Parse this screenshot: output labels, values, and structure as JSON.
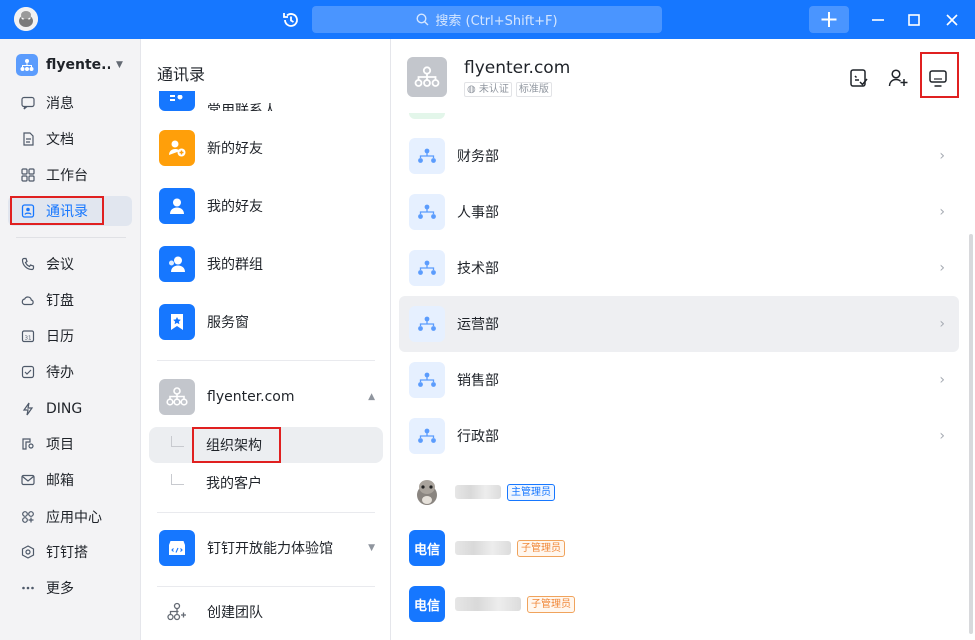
{
  "titlebar": {
    "search_placeholder": "搜索 (Ctrl+Shift+F)"
  },
  "sidebar": {
    "org_name": "flyente...",
    "items": [
      {
        "label": "消息",
        "icon": "message-icon"
      },
      {
        "label": "文档",
        "icon": "document-icon"
      },
      {
        "label": "工作台",
        "icon": "workbench-icon"
      },
      {
        "label": "通讯录",
        "icon": "contacts-icon",
        "active": true
      },
      {
        "label": "会议",
        "icon": "phone-icon"
      },
      {
        "label": "钉盘",
        "icon": "cloud-drive-icon"
      },
      {
        "label": "日历",
        "icon": "calendar-icon"
      },
      {
        "label": "待办",
        "icon": "todo-icon"
      },
      {
        "label": "DING",
        "icon": "ding-icon"
      },
      {
        "label": "项目",
        "icon": "project-icon"
      },
      {
        "label": "邮箱",
        "icon": "mail-icon"
      },
      {
        "label": "应用中心",
        "icon": "app-center-icon"
      },
      {
        "label": "钉钉搭",
        "icon": "builder-icon"
      },
      {
        "label": "更多",
        "icon": "more-icon"
      }
    ]
  },
  "middle": {
    "title": "通讯录",
    "partial_item": "常用联系人",
    "items": [
      {
        "label": "新的好友",
        "color": "#ff9f0a"
      },
      {
        "label": "我的好友",
        "color": "#1677ff"
      },
      {
        "label": "我的群组",
        "color": "#1677ff"
      },
      {
        "label": "服务窗",
        "color": "#1677ff"
      }
    ],
    "org": {
      "name": "flyenter.com"
    },
    "org_sub": [
      "组织架构",
      "我的客户"
    ],
    "experience": "钉钉开放能力体验馆",
    "create_team": "创建团队"
  },
  "right": {
    "org_title": "flyenter.com",
    "tags": [
      "未认证",
      "标准版"
    ],
    "departments": [
      "财务部",
      "人事部",
      "技术部",
      "运营部",
      "销售部",
      "行政部"
    ],
    "members": [
      {
        "avatar_text": "",
        "badge": "主管理员"
      },
      {
        "avatar_text": "电信",
        "badge": "子管理员"
      },
      {
        "avatar_text": "电信",
        "badge": "子管理员"
      }
    ]
  },
  "colors": {
    "accent": "#1677ff",
    "highlight_box": "#e02020"
  }
}
